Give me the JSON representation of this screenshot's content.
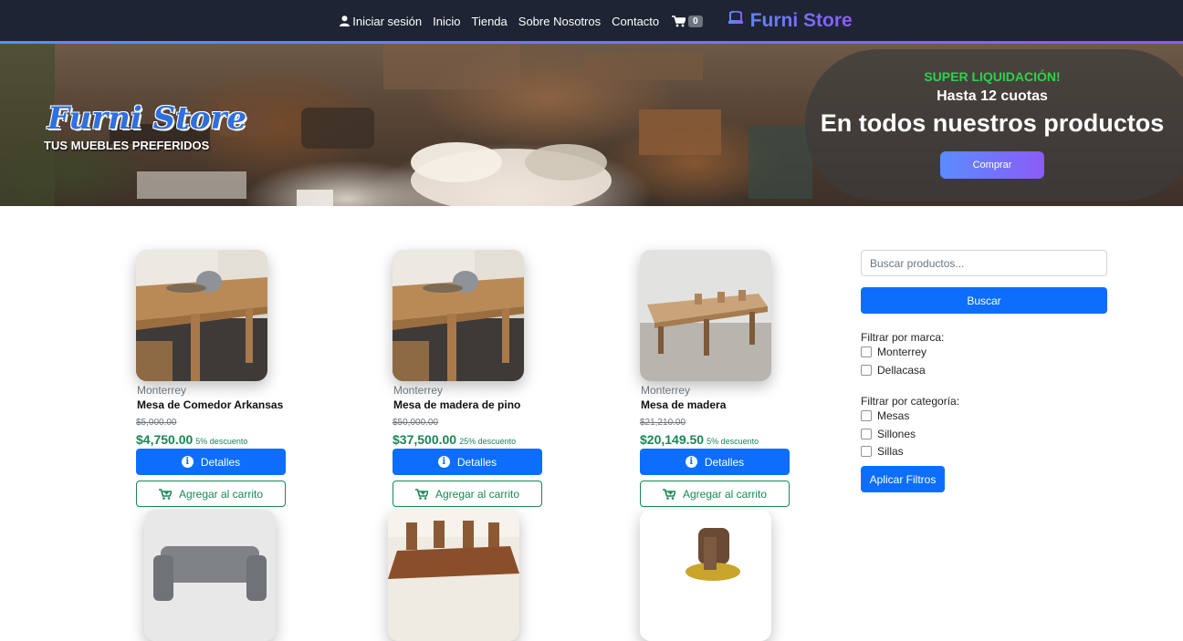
{
  "nav": {
    "login": "Iniciar sesión",
    "links": [
      "Inicio",
      "Tienda",
      "Sobre Nosotros",
      "Contacto"
    ],
    "cart_count": "0",
    "brand": "Furni Store"
  },
  "hero": {
    "title": "Furni Store",
    "subtitle": "TUS MUEBLES PREFERIDOS",
    "promo_line1": "SUPER LIQUIDACIÓN!",
    "promo_line2": "Hasta 12 cuotas",
    "promo_line3": "En todos nuestros productos",
    "promo_button": "Comprar"
  },
  "products": [
    {
      "brand": "Monterrey",
      "name": "Mesa de Comedor Arkansas",
      "old_price": "$5,000.00",
      "price": "$4,750.00",
      "discount": "5% descuento"
    },
    {
      "brand": "Monterrey",
      "name": "Mesa de madera de pino",
      "old_price": "$50,000.00",
      "price": "$37,500.00",
      "discount": "25% descuento"
    },
    {
      "brand": "Monterrey",
      "name": "Mesa de madera",
      "old_price": "$21,210.00",
      "price": "$20,149.50",
      "discount": "5% descuento"
    }
  ],
  "buttons": {
    "details": "Detalles",
    "add_to_cart": "Agregar al carrito"
  },
  "sidebar": {
    "search_placeholder": "Buscar productos...",
    "search_button": "Buscar",
    "brand_filter_title": "Filtrar por marca:",
    "brands": [
      "Monterrey",
      "Dellacasa"
    ],
    "category_filter_title": "Filtrar por categoría:",
    "categories": [
      "Mesas",
      "Sillones",
      "Sillas"
    ],
    "apply_button": "Aplicar Filtros"
  },
  "colors": {
    "nav_bg": "#1e2433",
    "primary": "#0d6efd",
    "success": "#198754",
    "brand_gradient_start": "#5b8cff",
    "brand_gradient_end": "#8a5cf6",
    "promo_green": "#2bd34a"
  }
}
